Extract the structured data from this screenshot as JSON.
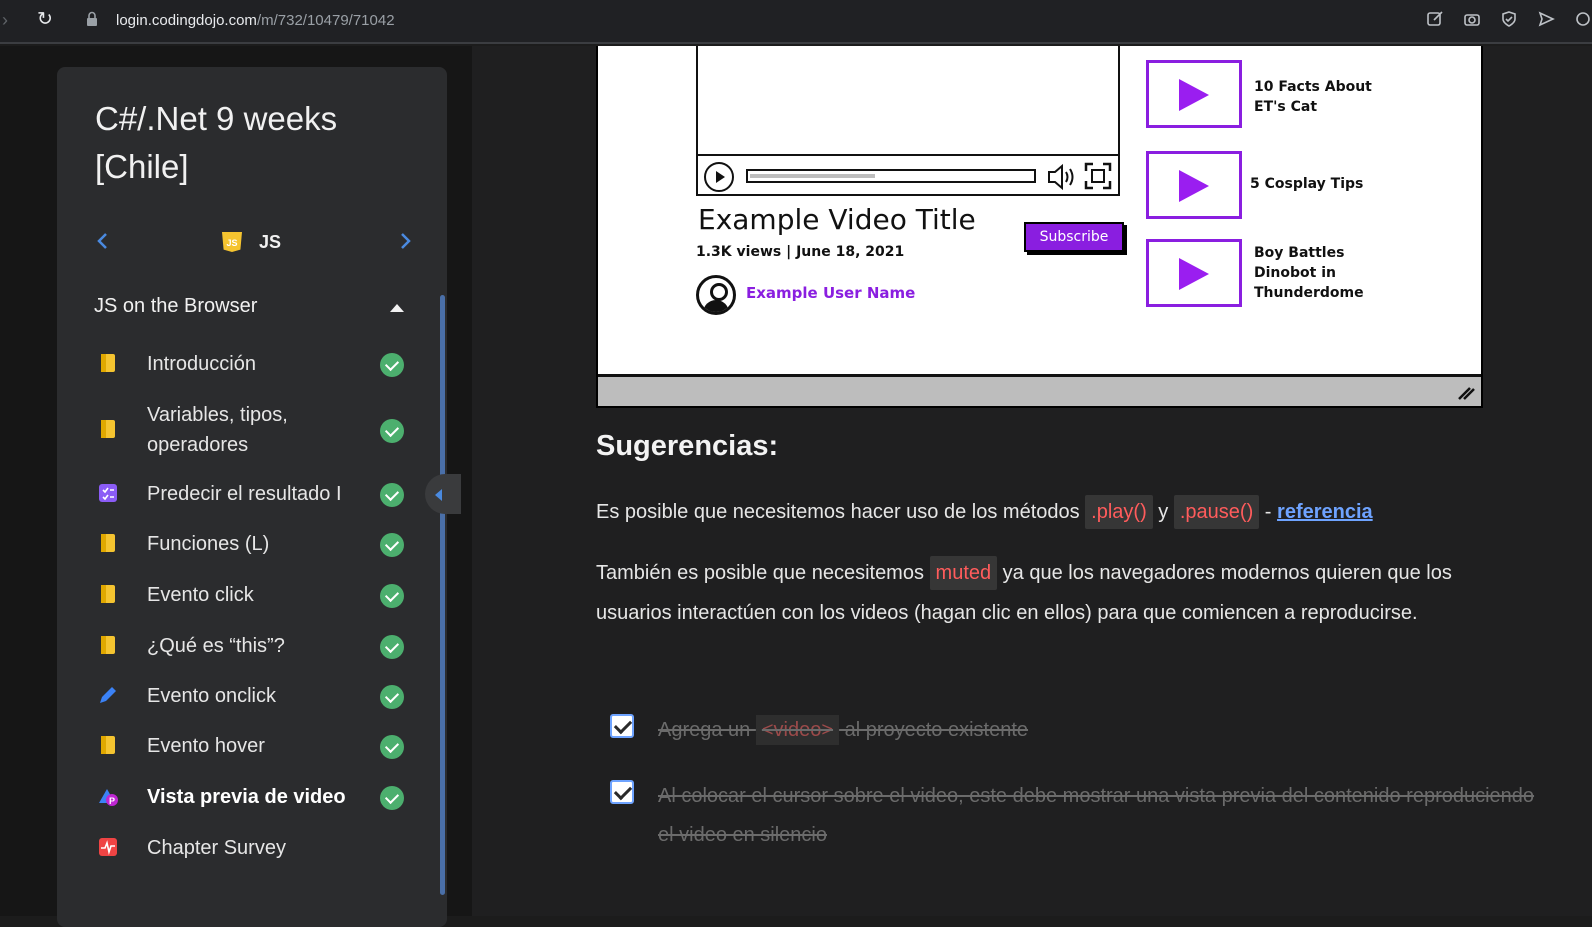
{
  "browser": {
    "url_host": "login.codingdojo.com",
    "url_path": "/m/732/10479/71042"
  },
  "sidebar": {
    "course_title": "C#/.Net 9 weeks [Chile]",
    "chapter": "JS",
    "section_title": "JS on the Browser",
    "lessons": [
      {
        "label": "Introducción",
        "icon": "book-icon",
        "done": true
      },
      {
        "label": "Variables, tipos, operadores",
        "icon": "book-icon",
        "done": true
      },
      {
        "label": "Predecir el resultado I",
        "icon": "quiz-icon",
        "done": true
      },
      {
        "label": "Funciones (L)",
        "icon": "book-icon",
        "done": true
      },
      {
        "label": "Evento click",
        "icon": "book-icon",
        "done": true
      },
      {
        "label": "¿Qué es “this”?",
        "icon": "book-icon",
        "done": true
      },
      {
        "label": "Evento onclick",
        "icon": "pencil-icon",
        "done": true
      },
      {
        "label": "Evento hover",
        "icon": "book-icon",
        "done": true
      },
      {
        "label": "Vista previa de video",
        "icon": "project-icon",
        "done": true,
        "active": true
      },
      {
        "label": "Chapter Survey",
        "icon": "survey-icon",
        "done": false
      }
    ]
  },
  "wireframe": {
    "video_title": "Example Video Title",
    "meta": "1.3K views  |  June 18, 2021",
    "subscribe": "Subscribe",
    "user_name": "Example User Name",
    "related": [
      "10 Facts About ET's Cat",
      "5 Cosplay Tips",
      "Boy Battles Dinobot in Thunderdome"
    ]
  },
  "content": {
    "heading": "Sugerencias:",
    "p1_pre": "Es posible que necesitemos hacer uso de los métodos ",
    "p1_code1": ".play()",
    "p1_mid": " y ",
    "p1_code2": ".pause()",
    "p1_dash": "  - ",
    "p1_link": "referencia",
    "p2_pre": "También es posible que necesitemos ",
    "p2_code": "muted",
    "p2_post": " ya que los navegadores modernos quieren que los usuarios interactúen con los videos (hagan clic en ellos) para que comiencen a reproducirse.",
    "task1_pre": "Agrega un ",
    "task1_code": "<video>",
    "task1_post": " al proyecto existente",
    "task2": "Al colocar el cursor sobre el video, este debe mostrar una vista previa del contenido reproduciendo el video en silencio"
  },
  "colors": {
    "accent": "#8a1ee0",
    "check": "#4caf6e",
    "link": "#6ea3ff",
    "code": "#ff5c5c"
  }
}
